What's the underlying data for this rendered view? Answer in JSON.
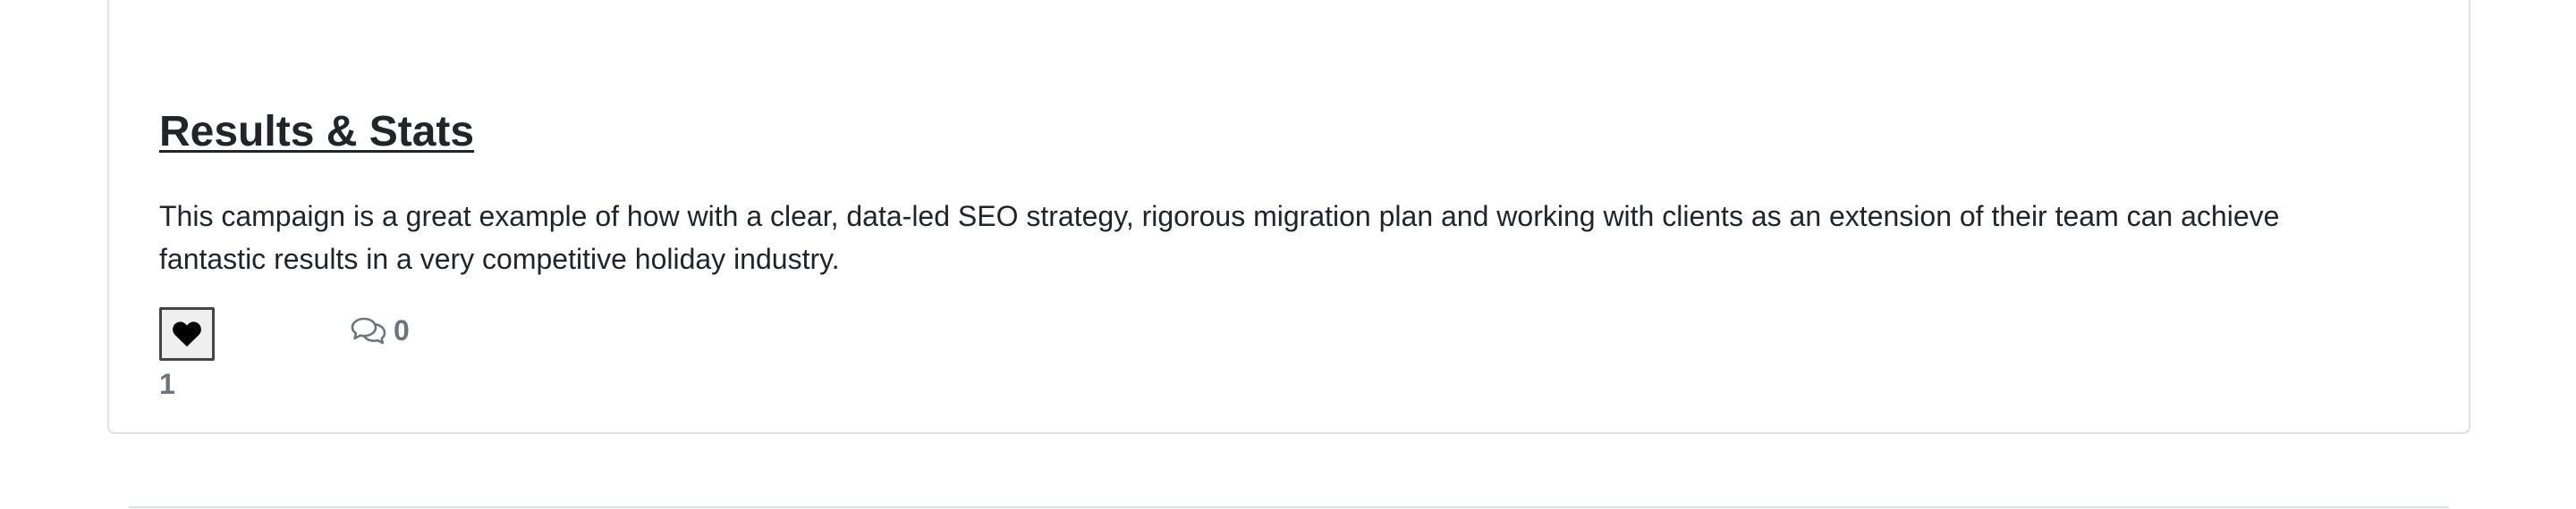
{
  "post": {
    "title": "Results & Stats",
    "body": "This campaign is a great example of how with a clear, data-led SEO strategy, rigorous migration plan and working with clients as an extension of their team can achieve fantastic results in a very competitive holiday industry.",
    "likes": {
      "icon": "heart-icon",
      "count": "1"
    },
    "comments": {
      "icon": "comments-icon",
      "count": "0"
    }
  }
}
